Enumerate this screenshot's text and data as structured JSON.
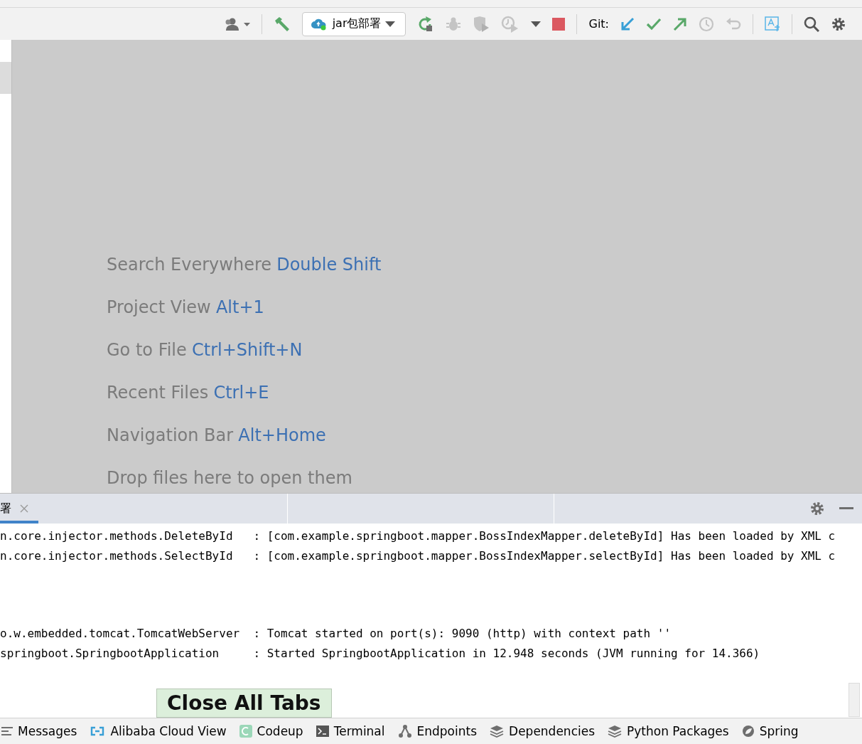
{
  "toolbar": {
    "run_config": "jar包部署",
    "git_label": "Git:"
  },
  "hints": [
    {
      "label": "Search Everywhere",
      "shortcut": "Double Shift"
    },
    {
      "label": "Project View",
      "shortcut": "Alt+1"
    },
    {
      "label": "Go to File",
      "shortcut": "Ctrl+Shift+N"
    },
    {
      "label": "Recent Files",
      "shortcut": "Ctrl+E"
    },
    {
      "label": "Navigation Bar",
      "shortcut": "Alt+Home"
    },
    {
      "label": "Drop files here to open them"
    }
  ],
  "run_panel": {
    "tab": {
      "label": "署",
      "selected": true
    },
    "console_lines_top": [
      "n.core.injector.methods.DeleteById   : [com.example.springboot.mapper.BossIndexMapper.deleteById] Has been loaded by XML c",
      "n.core.injector.methods.SelectById   : [com.example.springboot.mapper.BossIndexMapper.selectById] Has been loaded by XML c"
    ],
    "console_lines_bottom": [
      "o.w.embedded.tomcat.TomcatWebServer  : Tomcat started on port(s): 9090 (http) with context path ''",
      "springboot.SpringbootApplication     : Started SpringbootApplication in 12.948 seconds (JVM running for 14.366)"
    ]
  },
  "tooltip": "Close All Tabs",
  "tool_windows": [
    {
      "label": "Messages",
      "kind": "lines"
    },
    {
      "label": "Alibaba Cloud View",
      "kind": "cloud"
    },
    {
      "label": "Codeup",
      "kind": "codeup"
    },
    {
      "label": "Terminal",
      "kind": "terminal"
    },
    {
      "label": "Endpoints",
      "kind": "endpoints"
    },
    {
      "label": "Dependencies",
      "kind": "layers"
    },
    {
      "label": "Python Packages",
      "kind": "layers"
    },
    {
      "label": "Spring",
      "kind": "spring"
    }
  ]
}
